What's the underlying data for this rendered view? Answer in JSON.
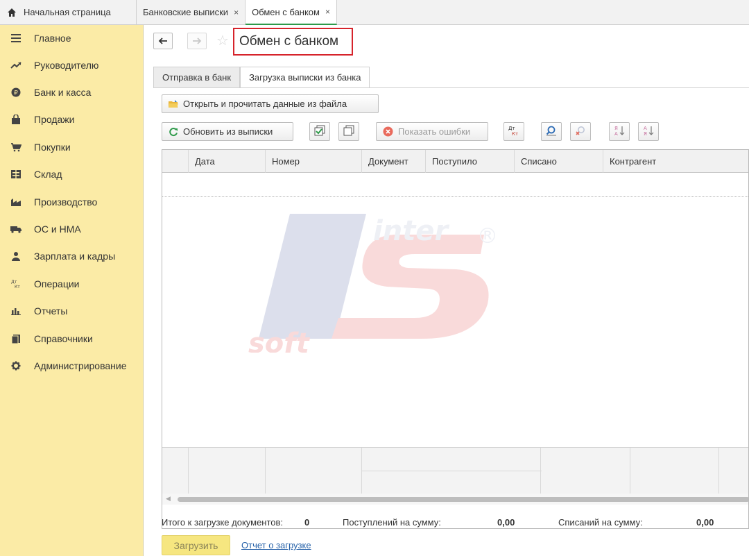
{
  "topbar": {
    "home_label": "Начальная страница",
    "tabs": [
      {
        "label": "Банковские выписки"
      },
      {
        "label": "Обмен с банком"
      }
    ],
    "close_glyph": "×"
  },
  "sidebar": {
    "items": [
      {
        "label": "Главное",
        "icon": "menu-icon"
      },
      {
        "label": "Руководителю",
        "icon": "trend-icon"
      },
      {
        "label": "Банк и касса",
        "icon": "coin-icon"
      },
      {
        "label": "Продажи",
        "icon": "bag-icon"
      },
      {
        "label": "Покупки",
        "icon": "cart-icon"
      },
      {
        "label": "Склад",
        "icon": "warehouse-icon"
      },
      {
        "label": "Производство",
        "icon": "factory-icon"
      },
      {
        "label": "ОС и НМА",
        "icon": "truck-icon"
      },
      {
        "label": "Зарплата и кадры",
        "icon": "person-icon"
      },
      {
        "label": "Операции",
        "icon": "dt-kt-icon"
      },
      {
        "label": "Отчеты",
        "icon": "bar-chart-icon"
      },
      {
        "label": "Справочники",
        "icon": "books-icon"
      },
      {
        "label": "Администрирование",
        "icon": "gear-icon"
      }
    ]
  },
  "header": {
    "title": "Обмен с банком"
  },
  "form_tabs": [
    {
      "label": "Отправка в банк"
    },
    {
      "label": "Загрузка выписки из банка"
    }
  ],
  "toolbar": {
    "open_file_label": "Открыть и прочитать данные из файла",
    "refresh_label": "Обновить из выписки",
    "show_errors_label": "Показать ошибки",
    "dt_kt_label": "Дт Кт"
  },
  "table": {
    "columns": [
      "Дата",
      "Номер",
      "Документ",
      "Поступило",
      "Списано",
      "Контрагент"
    ],
    "rows": []
  },
  "watermark": {
    "text_top": "inter",
    "text_bottom": "soft",
    "mark": "®"
  },
  "summary": {
    "docs_label": "Итого к загрузке документов:",
    "docs_count": "0",
    "income_label": "Поступлений на сумму:",
    "income_value": "0,00",
    "expense_label": "Списаний на сумму:",
    "expense_value": "0,00"
  },
  "footer": {
    "load_button": "Загрузить",
    "report_link": "Отчет о загрузке"
  },
  "colors": {
    "sidebar_bg": "#fbeba6",
    "title_highlight": "#d6232b",
    "active_tab_underline": "#2e9a4a",
    "link": "#2561a8"
  }
}
